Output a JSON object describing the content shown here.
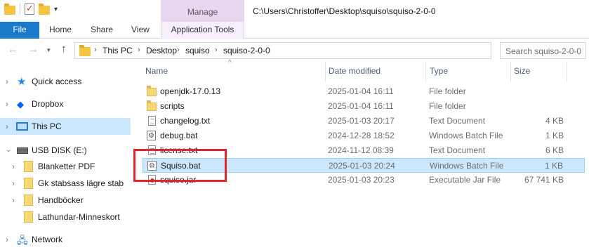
{
  "titlebar": {
    "manage_tab": "Manage",
    "path": "C:\\Users\\Christoffer\\Desktop\\squiso\\squiso-2-0-0"
  },
  "ribbon": {
    "tabs": [
      "File",
      "Home",
      "Share",
      "View",
      "Application Tools"
    ]
  },
  "address": {
    "crumbs": [
      "This PC",
      "Desktop",
      "squiso",
      "squiso-2-0-0"
    ],
    "search_placeholder": "Search squiso-2-0-0"
  },
  "sidebar": {
    "items": [
      {
        "label": "Quick access",
        "icon": "star-icon"
      },
      {
        "label": "Dropbox",
        "icon": "dropbox-icon"
      },
      {
        "label": "This PC",
        "icon": "computer-icon",
        "selected": true
      },
      {
        "label": "USB DISK (E:)",
        "icon": "usb-drive-icon",
        "expanded": true
      },
      {
        "label": "Blanketter PDF",
        "icon": "folder-icon"
      },
      {
        "label": "Gk stabsass lägre stab",
        "icon": "folder-icon"
      },
      {
        "label": "Handböcker",
        "icon": "folder-icon"
      },
      {
        "label": "Lathundar-Minneskort",
        "icon": "folder-icon"
      },
      {
        "label": "Network",
        "icon": "network-icon"
      }
    ]
  },
  "columns": [
    "Name",
    "Date modified",
    "Type",
    "Size"
  ],
  "files": [
    {
      "name": "openjdk-17.0.13",
      "date": "2025-01-04 16:11",
      "type": "File folder",
      "size": "",
      "icon": "folder-icon"
    },
    {
      "name": "scripts",
      "date": "2025-01-04 16:11",
      "type": "File folder",
      "size": "",
      "icon": "folder-icon"
    },
    {
      "name": "changelog.txt",
      "date": "2025-01-03 20:17",
      "type": "Text Document",
      "size": "4 KB",
      "icon": "text-file-icon"
    },
    {
      "name": "debug.bat",
      "date": "2024-12-28 18:52",
      "type": "Windows Batch File",
      "size": "1 KB",
      "icon": "batch-file-icon"
    },
    {
      "name": "license.txt",
      "date": "2024-11-12 08:39",
      "type": "Text Document",
      "size": "6 KB",
      "icon": "text-file-icon"
    },
    {
      "name": "Squiso.bat",
      "date": "2025-01-03 20:24",
      "type": "Windows Batch File",
      "size": "1 KB",
      "icon": "batch-file-icon",
      "selected": true
    },
    {
      "name": "squiso.jar",
      "date": "2025-01-03 20:23",
      "type": "Executable Jar File",
      "size": "67 741 KB",
      "icon": "jar-file-icon"
    }
  ],
  "colors": {
    "file_tab": "#1979ca",
    "manage_tab": "#e8d6f0",
    "selection": "#cce8ff",
    "annotation": "#e0262a"
  }
}
